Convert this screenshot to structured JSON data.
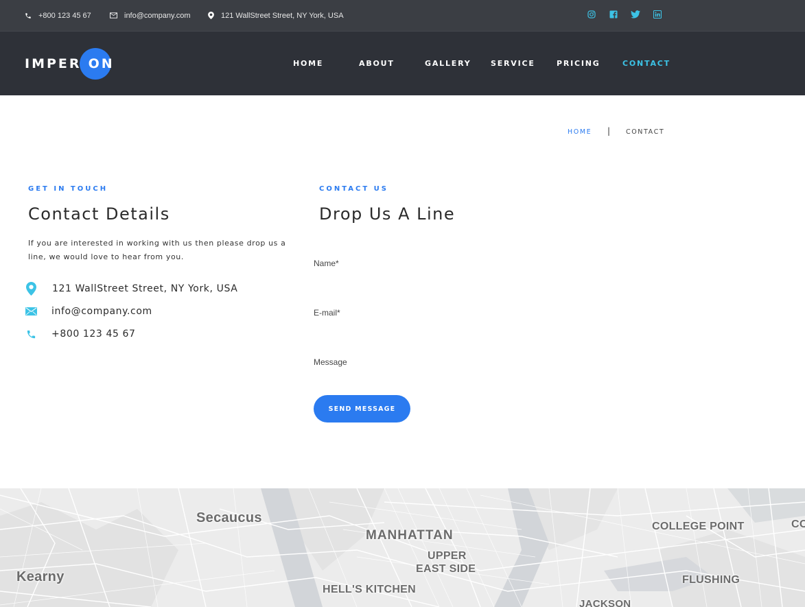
{
  "topbar": {
    "phone": "+800 123 45 67",
    "email": "info@company.com",
    "address": "121 WallStreet Street, NY York, USA",
    "social": [
      "instagram-icon",
      "facebook-icon",
      "twitter-icon",
      "linkedin-icon"
    ]
  },
  "header": {
    "logo_prefix": "IMPERI",
    "logo_suffix": "ON",
    "nav": [
      "HOME",
      "ABOUT",
      "GALLERY",
      "SERVICE",
      "PRICING",
      "CONTACT"
    ],
    "active": "CONTACT"
  },
  "breadcrumb": {
    "home": "HOME",
    "separator": "|",
    "current": "CONTACT"
  },
  "details": {
    "eyebrow": "GET IN TOUCH",
    "title": "Contact Details",
    "intro": "If you are interested in working with us then please drop us a line, we would love to hear from you.",
    "address": "121 WallStreet Street, NY York, USA",
    "email": "info@company.com",
    "phone": "+800 123 45 67"
  },
  "form": {
    "eyebrow": "CONTACT US",
    "title": "Drop Us A Line",
    "name_label": "Name*",
    "email_label": "E-mail*",
    "message_label": "Message",
    "submit": "SEND MESSAGE"
  },
  "map": {
    "labels": [
      "Secaucus",
      "MANHATTAN",
      "UPPER",
      "EAST SIDE",
      "COLLEGE POINT",
      "Kearny",
      "HELL'S KITCHEN",
      "FLUSHING",
      "JACKSON",
      "CO"
    ]
  },
  "colors": {
    "accent": "#2b7bf0",
    "nav_active": "#3cc3e6",
    "topbar_bg": "#3b3e44",
    "header_bg": "#2e3138"
  }
}
